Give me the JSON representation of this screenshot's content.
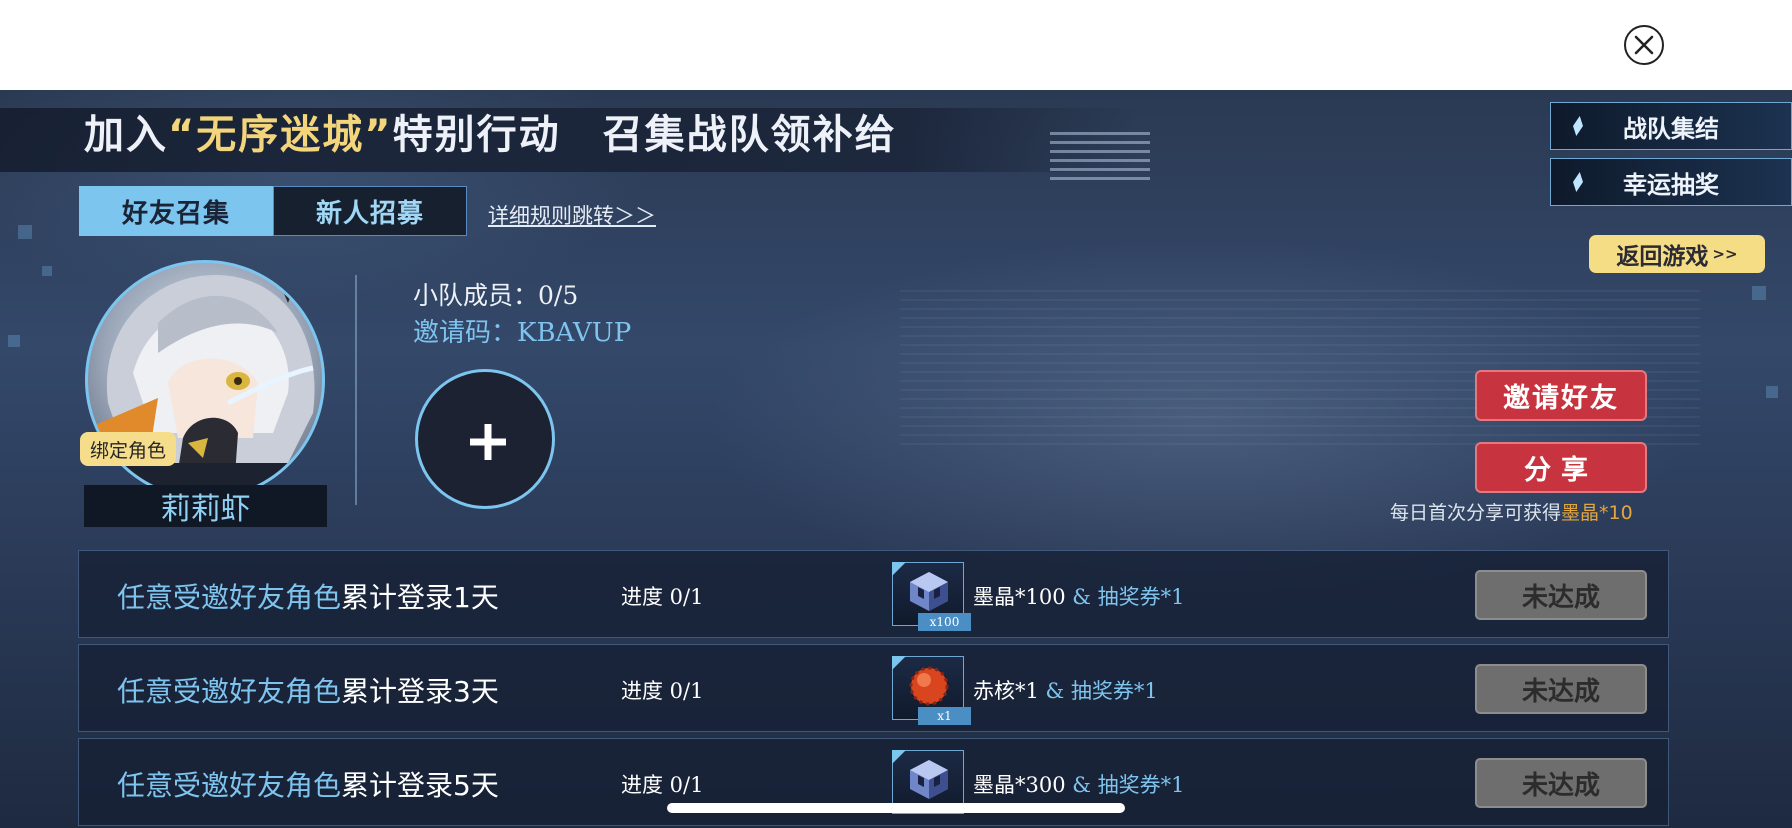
{
  "topbar": {
    "close_icon": "close-circle-icon"
  },
  "banner": {
    "title_part1": "加入",
    "title_quoted": "“无序迷城”",
    "title_part2": "特别行动　召集战队领补给"
  },
  "tabs": [
    {
      "label": "好友召集",
      "active": true
    },
    {
      "label": "新人招募",
      "active": false
    }
  ],
  "rules_link": "详细规则跳转＞＞",
  "side_menu": [
    {
      "label": "战队集结",
      "icon": "diamond-icon"
    },
    {
      "label": "幸运抽奖",
      "icon": "diamond-icon"
    }
  ],
  "return_button": {
    "label": "返回游戏",
    "suffix": ">>"
  },
  "character": {
    "bind_badge": "绑定角色",
    "name": "莉莉虾"
  },
  "squad": {
    "members_label": "小队成员：",
    "members_value": "0/5",
    "code_label": "邀请码：",
    "code_value": "KBAVUP"
  },
  "actions": {
    "invite_label": "邀请好友",
    "share_label": "分享",
    "share_note_prefix": "每日首次分享可获得",
    "share_note_reward": "墨晶*10"
  },
  "tasks": [
    {
      "title_highlight": "任意受邀好友角色",
      "title_rest": "累计登录1天",
      "progress": "进度 0/1",
      "reward_icon": "crystal-cube-icon",
      "reward_qty": "x100",
      "reward_main": "墨晶*100",
      "reward_extra": " & 抽奖券*1",
      "status": "未达成"
    },
    {
      "title_highlight": "任意受邀好友角色",
      "title_rest": "累计登录3天",
      "progress": "进度 0/1",
      "reward_icon": "red-core-icon",
      "reward_qty": "x1",
      "reward_main": "赤核*1",
      "reward_extra": " & 抽奖券*1",
      "status": "未达成"
    },
    {
      "title_highlight": "任意受邀好友角色",
      "title_rest": "累计登录5天",
      "progress": "进度 0/1",
      "reward_icon": "crystal-cube-icon",
      "reward_qty": "",
      "reward_main": "墨晶*300",
      "reward_extra": " & 抽奖券*1",
      "status": "未达成"
    }
  ],
  "colors": {
    "accent_blue": "#7cc5ee",
    "gold": "#f4dd85",
    "red_button": "#c7343f",
    "disabled_button": "#6e6e6e"
  }
}
